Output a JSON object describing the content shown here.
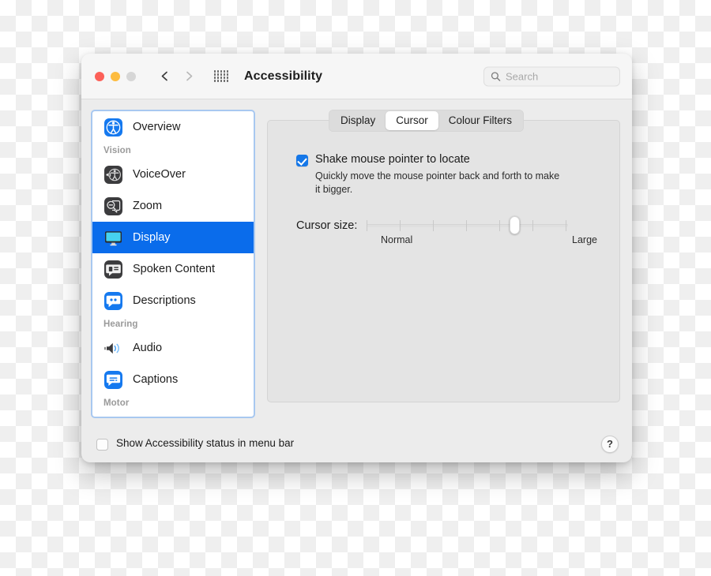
{
  "window": {
    "title": "Accessibility",
    "traffic_lights": [
      "close-red",
      "minimize-amber",
      "zoom-grey"
    ],
    "back_icon": "chevron-left-icon",
    "forward_icon": "chevron-right-icon",
    "grid_icon": "show-all-grid-icon"
  },
  "search": {
    "placeholder": "Search",
    "value": "",
    "icon": "search-icon"
  },
  "sidebar": {
    "items": [
      {
        "label": "Overview",
        "icon": "accessibility-icon",
        "kind": "item",
        "selected": false
      },
      {
        "label": "Vision",
        "kind": "group"
      },
      {
        "label": "VoiceOver",
        "icon": "voiceover-icon",
        "kind": "item",
        "selected": false
      },
      {
        "label": "Zoom",
        "icon": "zoom-magnifier-icon",
        "kind": "item",
        "selected": false
      },
      {
        "label": "Display",
        "icon": "display-monitor-icon",
        "kind": "item",
        "selected": true
      },
      {
        "label": "Spoken Content",
        "icon": "spoken-content-icon",
        "kind": "item",
        "selected": false
      },
      {
        "label": "Descriptions",
        "icon": "descriptions-icon",
        "kind": "item",
        "selected": false
      },
      {
        "label": "Hearing",
        "kind": "group"
      },
      {
        "label": "Audio",
        "icon": "audio-speaker-icon",
        "kind": "item",
        "selected": false
      },
      {
        "label": "Captions",
        "icon": "captions-icon",
        "kind": "item",
        "selected": false
      },
      {
        "label": "Motor",
        "kind": "group"
      }
    ]
  },
  "tabs": [
    {
      "label": "Display",
      "active": false
    },
    {
      "label": "Cursor",
      "active": true
    },
    {
      "label": "Colour Filters",
      "active": false
    }
  ],
  "main": {
    "shake_checkbox": {
      "label": "Shake mouse pointer to locate",
      "checked": true,
      "description": "Quickly move the mouse pointer back and forth to make it bigger."
    },
    "cursor_size": {
      "label": "Cursor size:",
      "min_label": "Normal",
      "max_label": "Large",
      "ticks": 7,
      "value_index": 5
    }
  },
  "footer": {
    "status_checkbox": {
      "label": "Show Accessibility status in menu bar",
      "checked": false
    },
    "help_label": "?",
    "help_icon": "question-mark-icon"
  },
  "colors": {
    "accent": "#0a6ceb",
    "checkbox": "#1577e8",
    "window_bg": "#ececec",
    "panel_bg": "#e4e4e4"
  }
}
